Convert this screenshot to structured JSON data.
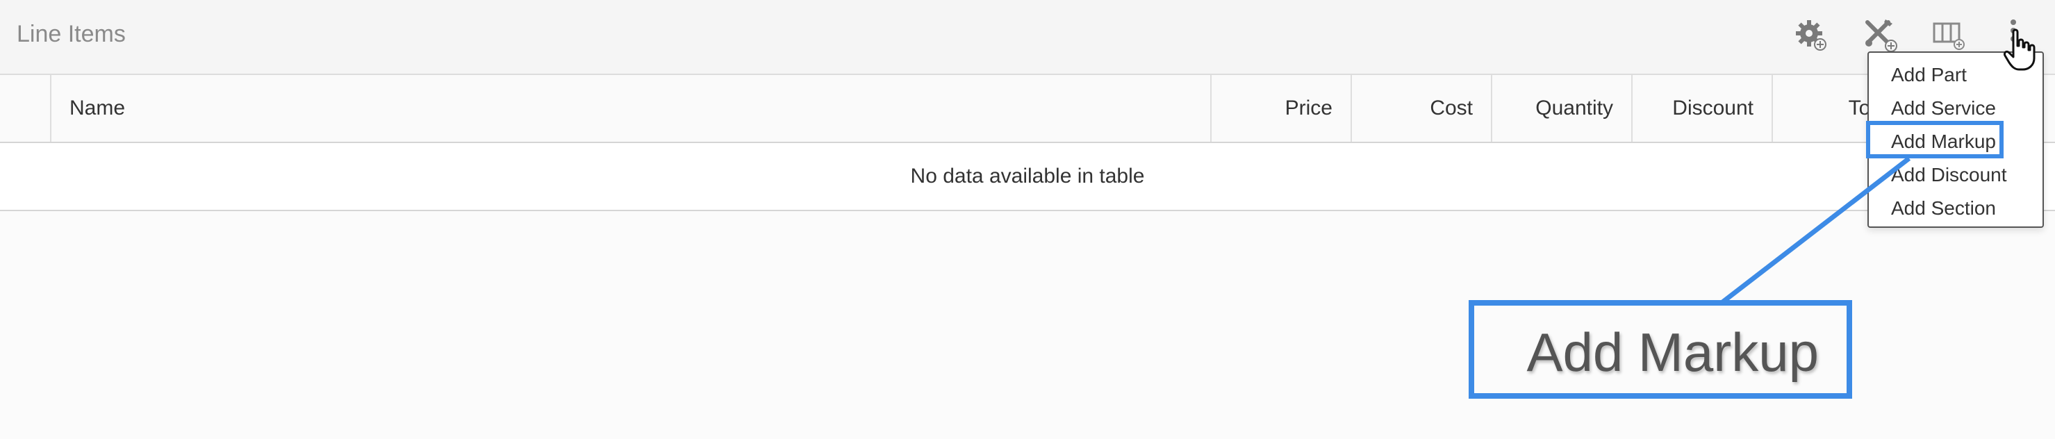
{
  "panel": {
    "title": "Line Items"
  },
  "toolbar": {
    "icons": [
      "settings-add-icon",
      "tools-add-icon",
      "columns-add-icon",
      "more-vertical-icon"
    ]
  },
  "table": {
    "columns": [
      "",
      "Name",
      "Price",
      "Cost",
      "Quantity",
      "Discount",
      "Total"
    ],
    "empty_message": "No data available in table"
  },
  "menu": {
    "items": [
      "Add Part",
      "Add Service",
      "Add Markup",
      "Add Discount",
      "Add Section"
    ],
    "highlighted_item": "Add Markup"
  },
  "callout": {
    "text": "Add Markup"
  },
  "colors": {
    "accent": "#3d8be6",
    "header_bg": "#f5f5f5",
    "border": "#d5d5d5"
  }
}
